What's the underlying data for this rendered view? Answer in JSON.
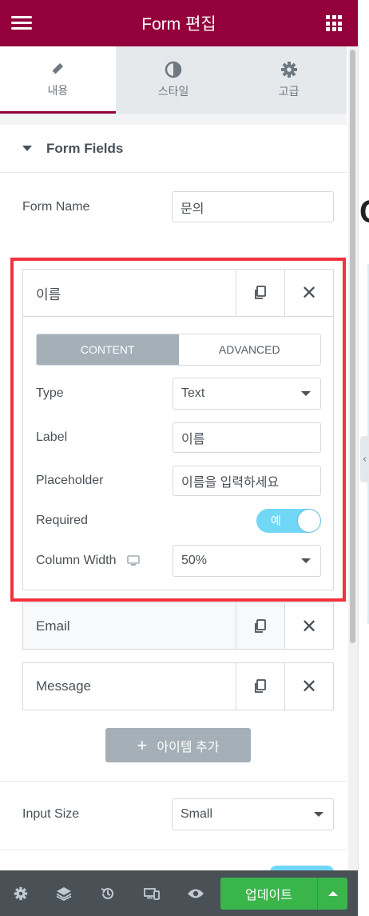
{
  "header": {
    "title": "Form 편집"
  },
  "tabs": [
    {
      "label": "내용",
      "icon": "pencil-icon",
      "active": true
    },
    {
      "label": "스타일",
      "icon": "contrast-icon",
      "active": false
    },
    {
      "label": "고급",
      "icon": "gear-icon",
      "active": false
    }
  ],
  "section": {
    "title": "Form Fields"
  },
  "form_name": {
    "label": "Form Name",
    "value": "문의"
  },
  "fields": [
    {
      "title": "이름",
      "expanded": true,
      "inner_tabs": [
        "CONTENT",
        "ADVANCED"
      ],
      "type": {
        "label": "Type",
        "value": "Text"
      },
      "field_label": {
        "label": "Label",
        "value": "이름"
      },
      "placeholder": {
        "label": "Placeholder",
        "value": "이름을 입력하세요"
      },
      "required": {
        "label": "Required",
        "value": "예"
      },
      "column_width": {
        "label": "Column Width",
        "value": "50%"
      }
    },
    {
      "title": "Email",
      "expanded": false
    },
    {
      "title": "Message",
      "expanded": false
    }
  ],
  "add_item": {
    "label": "아이템 추가"
  },
  "input_size": {
    "label": "Input Size",
    "value": "Small"
  },
  "footer": {
    "update_label": "업데이트"
  },
  "colors": {
    "brand": "#93003c",
    "update": "#39b54a",
    "highlight": "#f2313d",
    "toggle": "#71d7f7"
  }
}
